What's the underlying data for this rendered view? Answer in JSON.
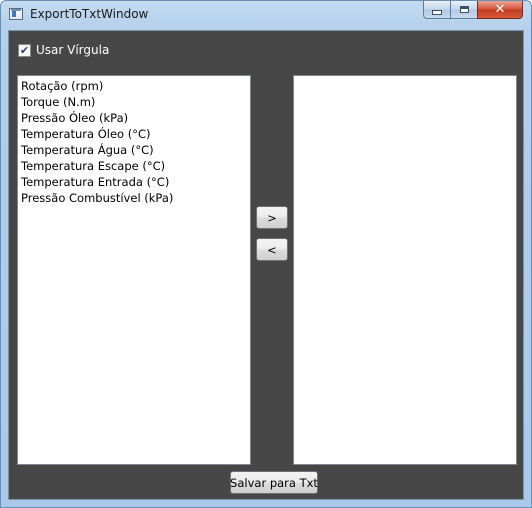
{
  "window": {
    "title": "ExportToTxtWindow",
    "controls": {
      "close_glyph": "✕"
    }
  },
  "options": {
    "use_comma_label": "Usar Vírgula",
    "use_comma_checked": true,
    "check_glyph": "✔"
  },
  "available_list": {
    "items": [
      "Rotação (rpm)",
      "Torque (N.m)",
      "Pressão Óleo (kPa)",
      "Temperatura Óleo (°C)",
      "Temperatura Água (°C)",
      "Temperatura Escape (°C)",
      "Temperatura Entrada (°C)",
      "Pressão Combustível (kPa)"
    ]
  },
  "selected_list": {
    "items": []
  },
  "buttons": {
    "add_label": ">",
    "remove_label": "<",
    "save_label": "Salvar para Txt"
  }
}
